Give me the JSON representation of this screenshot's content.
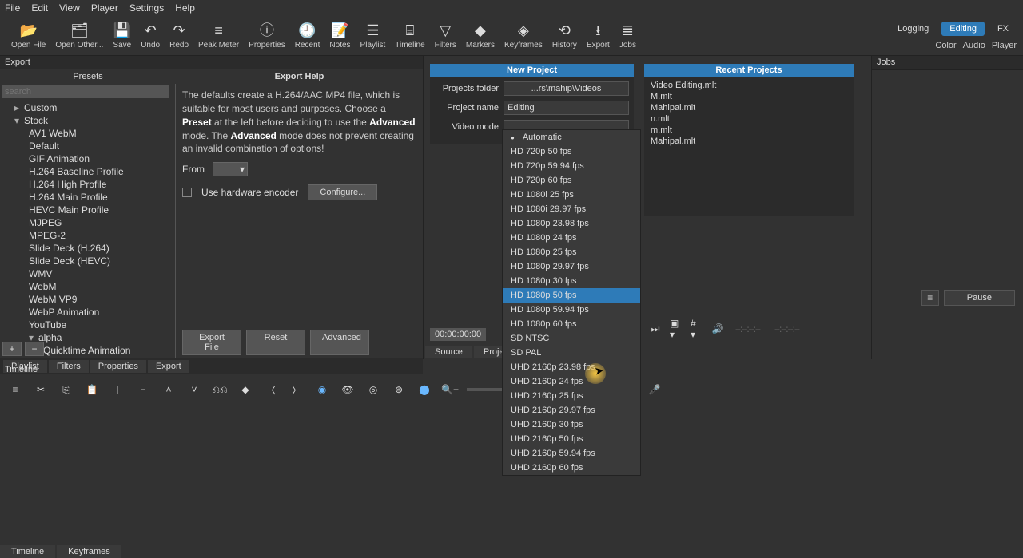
{
  "menubar": [
    "File",
    "Edit",
    "View",
    "Player",
    "Settings",
    "Help"
  ],
  "toolbar": [
    {
      "id": "open-file",
      "label": "Open File",
      "icon": "folder-open"
    },
    {
      "id": "open-other",
      "label": "Open Other...",
      "icon": "folders"
    },
    {
      "id": "save",
      "label": "Save",
      "icon": "floppy"
    },
    {
      "id": "undo",
      "label": "Undo",
      "icon": "undo"
    },
    {
      "id": "redo",
      "label": "Redo",
      "icon": "redo"
    },
    {
      "id": "peak",
      "label": "Peak Meter",
      "icon": "bars"
    },
    {
      "id": "properties",
      "label": "Properties",
      "icon": "info"
    },
    {
      "id": "recent",
      "label": "Recent",
      "icon": "clock"
    },
    {
      "id": "notes",
      "label": "Notes",
      "icon": "note"
    },
    {
      "id": "playlist",
      "label": "Playlist",
      "icon": "list"
    },
    {
      "id": "timeline",
      "label": "Timeline",
      "icon": "timeline"
    },
    {
      "id": "filters",
      "label": "Filters",
      "icon": "funnel"
    },
    {
      "id": "markers",
      "label": "Markers",
      "icon": "marker"
    },
    {
      "id": "keyframes",
      "label": "Keyframes",
      "icon": "keyframe"
    },
    {
      "id": "history",
      "label": "History",
      "icon": "history"
    },
    {
      "id": "export",
      "label": "Export",
      "icon": "export"
    },
    {
      "id": "jobs",
      "label": "Jobs",
      "icon": "jobs"
    }
  ],
  "layout_tabs": {
    "top": [
      "Logging",
      "Editing",
      "FX"
    ],
    "top_active": "Editing",
    "bottom": [
      "Color",
      "Audio",
      "Player"
    ]
  },
  "export_panel": {
    "title": "Export",
    "presets_title": "Presets",
    "search_placeholder": "search",
    "tree": [
      {
        "label": "Custom",
        "expand": false,
        "level": 0
      },
      {
        "label": "Stock",
        "expand": true,
        "level": 0
      },
      {
        "label": "AV1 WebM",
        "level": 1
      },
      {
        "label": "Default",
        "level": 1
      },
      {
        "label": "GIF Animation",
        "level": 1
      },
      {
        "label": "H.264 Baseline Profile",
        "level": 1
      },
      {
        "label": "H.264 High Profile",
        "level": 1
      },
      {
        "label": "H.264 Main Profile",
        "level": 1
      },
      {
        "label": "HEVC Main Profile",
        "level": 1
      },
      {
        "label": "MJPEG",
        "level": 1
      },
      {
        "label": "MPEG-2",
        "level": 1
      },
      {
        "label": "Slide Deck (H.264)",
        "level": 1
      },
      {
        "label": "Slide Deck (HEVC)",
        "level": 1
      },
      {
        "label": "WMV",
        "level": 1
      },
      {
        "label": "WebM",
        "level": 1
      },
      {
        "label": "WebM VP9",
        "level": 1
      },
      {
        "label": "WebP Animation",
        "level": 1
      },
      {
        "label": "YouTube",
        "level": 1
      },
      {
        "label": "alpha",
        "expand": true,
        "level": 1
      },
      {
        "label": "Quicktime Animation",
        "level": 2
      }
    ],
    "help_title": "Export Help",
    "help_parts": {
      "p1": "The defaults create a H.264/AAC MP4 file, which is suitable for most users and purposes. Choose a ",
      "p2": "Preset",
      "p3": " at the left before deciding to use the ",
      "p4": "Advanced",
      "p5": " mode. The ",
      "p6": "Advanced",
      "p7": " mode does not prevent creating an invalid combination of options!"
    },
    "from_label": "From",
    "hw_label": "Use hardware encoder",
    "configure_btn": "Configure...",
    "buttons": [
      "Export File",
      "Reset",
      "Advanced"
    ]
  },
  "left_tabs": [
    "Playlist",
    "Filters",
    "Properties",
    "Export"
  ],
  "new_project": {
    "title": "New Project",
    "folder_label": "Projects folder",
    "folder_value": "...rs\\mahip\\Videos",
    "name_label": "Project name",
    "name_value": "Editing",
    "mode_label": "Video mode",
    "mode_value": "Automatic"
  },
  "video_modes": [
    "Automatic",
    "HD 720p 50 fps",
    "HD 720p 59.94 fps",
    "HD 720p 60 fps",
    "HD 1080i 25 fps",
    "HD 1080i 29.97 fps",
    "HD 1080p 23.98 fps",
    "HD 1080p 24 fps",
    "HD 1080p 25 fps",
    "HD 1080p 29.97 fps",
    "HD 1080p 30 fps",
    "HD 1080p 50 fps",
    "HD 1080p 59.94 fps",
    "HD 1080p 60 fps",
    "SD NTSC",
    "SD PAL",
    "UHD 2160p 23.98 fps",
    "UHD 2160p 24 fps",
    "UHD 2160p 25 fps",
    "UHD 2160p 29.97 fps",
    "UHD 2160p 30 fps",
    "UHD 2160p 50 fps",
    "UHD 2160p 59.94 fps",
    "UHD 2160p 60 fps"
  ],
  "video_mode_selected": "Automatic",
  "video_mode_hover": "HD 1080p 50 fps",
  "recent": {
    "title": "Recent Projects",
    "items": [
      "Video Editing.mlt",
      "M.mlt",
      "Mahipal.mlt",
      "n.mlt",
      "m.mlt",
      "Mahipal.mlt"
    ]
  },
  "jobs": {
    "title": "Jobs"
  },
  "player": {
    "timecode": "00:00:00:00",
    "in_out1": "--:--:--:--",
    "in_out2": "--:--:--:--"
  },
  "center_tabs": [
    "Source",
    "Proje"
  ],
  "pause_label": "Pause",
  "timeline": {
    "title": "Timeline"
  },
  "bottom_tabs": [
    "Timeline",
    "Keyframes"
  ]
}
